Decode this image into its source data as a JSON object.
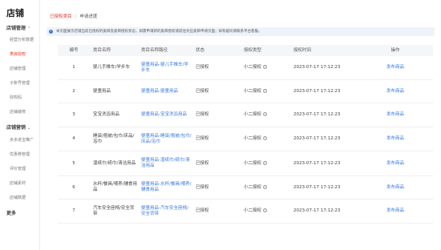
{
  "sidebar": {
    "title": "店铺",
    "groups": [
      {
        "label": "店铺管理",
        "items": [
          "经营分析数据",
          "类目授权",
          "店铺管理",
          "子账号管理",
          "授权码",
          "店铺装修"
        ]
      },
      {
        "label": "店铺营销",
        "items": [
          "多多进宝推广",
          "优惠券管理",
          "评价管理",
          "店铺素材",
          "店铺数据"
        ]
      }
    ],
    "more": "更多"
  },
  "breadcrumb": {
    "parent": "已授权类目",
    "separator": "|",
    "current": "申请进度"
  },
  "notice": {
    "icon": "info-icon",
    "text": "本页面展示店铺当前已授权的类目及类目授权状态，如需申请新的类目授权请前往对应类目申请页面；如有疑问请联系平台客服。"
  },
  "table": {
    "headers": [
      "编号",
      "类目名称",
      "类目名称路径",
      "状态",
      "授权类型",
      "授权时间",
      "操作"
    ],
    "rows": [
      {
        "idx": "1",
        "name": "婴儿手推车/学步车",
        "path": "婴童用品-婴儿手推车/学步车",
        "status": "已授权",
        "type": "小二授权",
        "time": "2023-07-17 17:12:23",
        "op": "发布商品"
      },
      {
        "idx": "2",
        "name": "婴童用品",
        "path": "婴童用品-婴童用品",
        "status": "已授权",
        "type": "小二授权",
        "time": "2023-07-17 17:12:23",
        "op": "发布商品"
      },
      {
        "idx": "3",
        "name": "宝宝洗浴用品",
        "path": "婴童用品-宝宝洗浴用品",
        "status": "已授权",
        "type": "小二授权",
        "time": "2023-07-17 17:12:23",
        "op": "发布商品"
      },
      {
        "idx": "4",
        "name": "睡袋/抱被/包巾/床品/浴巾",
        "path": "婴童用品-睡袋/抱被/包巾/床品/浴巾",
        "status": "已授权",
        "type": "小二授权",
        "time": "2023-07-17 17:12:23",
        "op": "发布商品"
      },
      {
        "idx": "5",
        "name": "湿纸巾/纸巾/清洁用品",
        "path": "婴童用品-湿纸巾/纸巾/清洁用品",
        "status": "已授权",
        "type": "小二授权",
        "time": "2023-07-17 17:12:23",
        "op": "发布商品"
      },
      {
        "idx": "6",
        "name": "水杯/餐具/喂养/辅食用品",
        "path": "婴童用品-水杯/餐具/喂养/辅食用品",
        "status": "已授权",
        "type": "小二授权",
        "time": "2023-07-17 17:12:23",
        "op": "发布商品"
      },
      {
        "idx": "7",
        "name": "汽车安全座椅/安全背带",
        "path": "婴童用品-汽车安全座椅/安全背带",
        "status": "已授权",
        "type": "小二授权",
        "time": "2023-07-17 17:12:23",
        "op": "发布商品"
      }
    ]
  },
  "colors": {
    "accent": "#e02e24",
    "link": "#3b78e7",
    "notice_bg": "#eef3fb",
    "header_bg": "#f5f6f8"
  }
}
